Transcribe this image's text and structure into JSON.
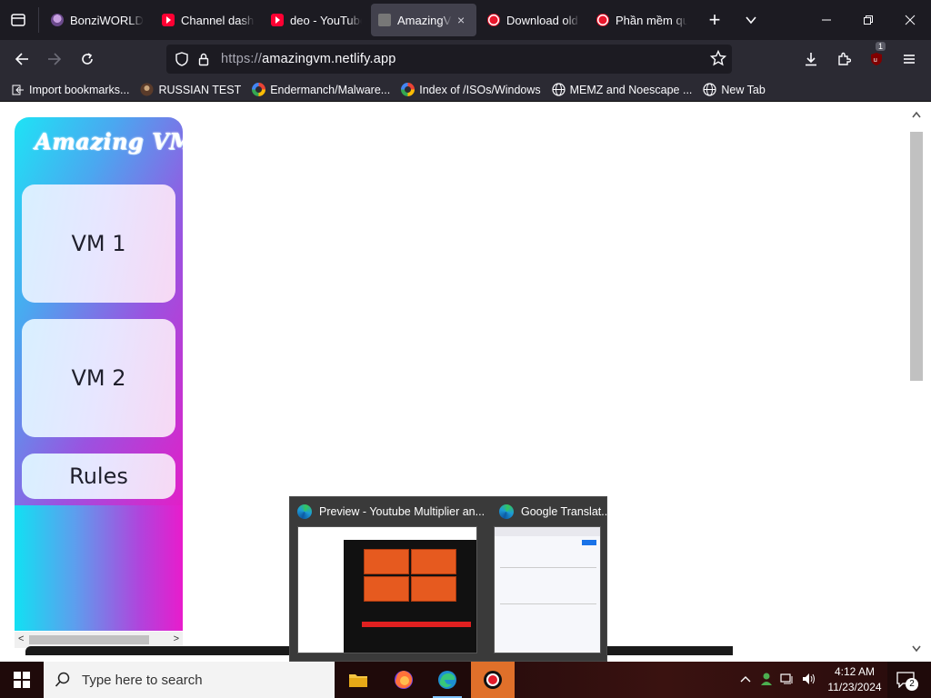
{
  "browser": {
    "tabs": [
      {
        "title": "BonziWORLD",
        "favicon": "bonzi-favicon"
      },
      {
        "title": "Channel dashboard - YouTube",
        "favicon": "youtube-favicon"
      },
      {
        "title": "deo - YouTube",
        "favicon": "youtube-favicon"
      },
      {
        "title": "AmazingVM",
        "favicon": "amazingvm-favicon",
        "active": true,
        "close": "×"
      },
      {
        "title": "Download old versions",
        "favicon": "record-favicon"
      },
      {
        "title": "Phần mềm quay màn hình",
        "favicon": "record-favicon"
      }
    ],
    "new_tab": "+",
    "list_tabs": "⌄",
    "window_controls": {
      "minimize": "—",
      "restore": "❐",
      "close": "✕"
    },
    "url": {
      "protocol": "https://",
      "host": "amazingvm.netlify.app"
    },
    "extension_badge": "1",
    "bookmarks": [
      {
        "label": "Import bookmarks...",
        "icon": "import-icon"
      },
      {
        "label": "RUSSIAN TEST",
        "icon": "avatar-icon"
      },
      {
        "label": "Endermanch/Malware...",
        "icon": "google-icon"
      },
      {
        "label": "Index of /ISOs/Windows",
        "icon": "google-icon"
      },
      {
        "label": "MEMZ and Noescape ...",
        "icon": "globe-icon"
      },
      {
        "label": "New Tab",
        "icon": "globe-icon"
      }
    ]
  },
  "page": {
    "logo_text": "Amazing VM",
    "nav": [
      {
        "label": "VM 1"
      },
      {
        "label": "VM 2"
      },
      {
        "label": "Rules"
      }
    ],
    "scroll_arrows": {
      "left": "<",
      "right": ">",
      "up": "^",
      "down": "v"
    }
  },
  "thumbnails": [
    {
      "title": "Preview - Youtube Multiplier an..."
    },
    {
      "title": "Google Translat..."
    }
  ],
  "taskbar": {
    "search_placeholder": "Type here to search",
    "apps": [
      "file-explorer",
      "firefox",
      "edge",
      "recorder"
    ],
    "time": "4:12 AM",
    "date": "11/23/2024",
    "notification_count": "2"
  },
  "colors": {
    "gradient_cyan": "#1ee3f5",
    "gradient_magenta": "#e020c8",
    "browser_dark": "#1c1b22",
    "toolbar": "#2b2a33"
  }
}
